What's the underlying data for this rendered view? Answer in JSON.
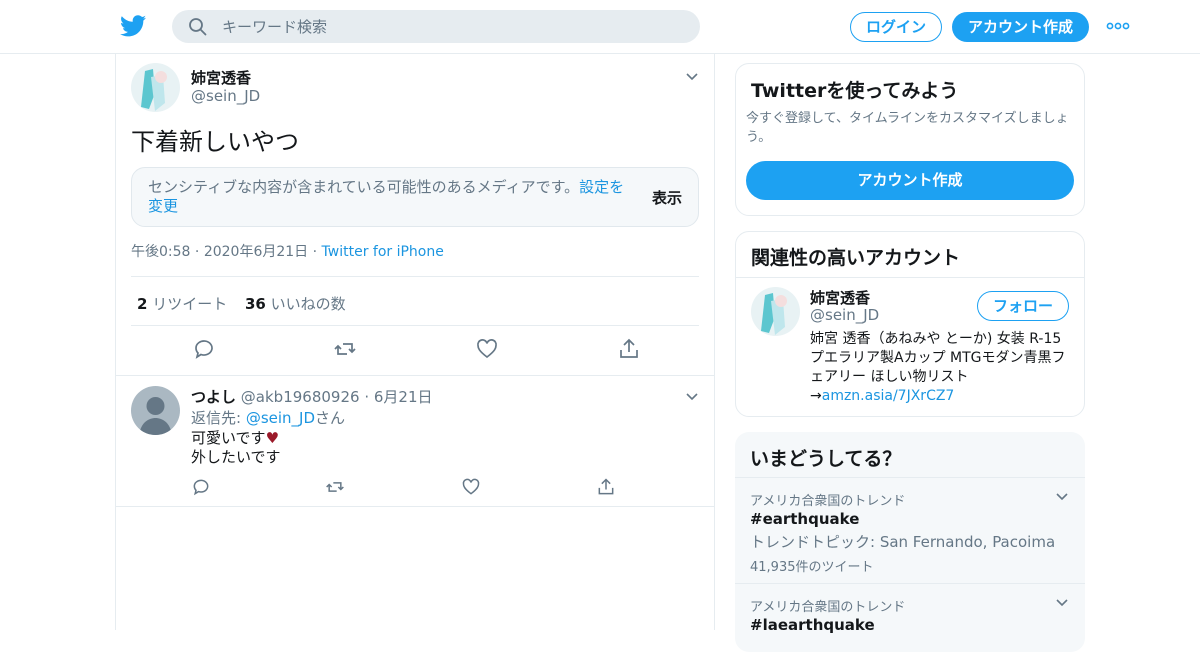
{
  "header": {
    "search_placeholder": "キーワード検索",
    "login_label": "ログイン",
    "signup_label": "アカウント作成"
  },
  "tweet": {
    "display_name": "姉宮透香",
    "handle": "@sein_JD",
    "text": "下着新しいやつ",
    "sensitive_message": "センシティブな内容が含まれている可能性のあるメディアです。",
    "sensitive_link": "設定を変更",
    "sensitive_show": "表示",
    "time": "午後0:58",
    "date": "2020年6月21日",
    "source": "Twitter for iPhone",
    "retweet_count": "2",
    "retweet_label": "リツイート",
    "like_count": "36",
    "like_label": "いいねの数"
  },
  "reply": {
    "display_name": "つよし",
    "handle": "@akb19680926",
    "date": "6月21日",
    "reply_prefix": "返信先: ",
    "reply_handle": "@sein_JD",
    "reply_suffix": "さん",
    "line1": "可愛いです",
    "line2": "外したいです"
  },
  "signup_card": {
    "title": "Twitterを使ってみよう",
    "description": "今すぐ登録して、タイムラインをカスタマイズしましょう。",
    "button": "アカウント作成"
  },
  "related_card": {
    "title": "関連性の高いアカウント",
    "display_name": "姉宮透香",
    "handle": "@sein_JD",
    "follow_label": "フォロー",
    "bio": "姉宮 透香（あねみや とーか) 女装 R-15 プエラリア製Aカップ MTGモダン青黒フェアリー ほしい物リスト→",
    "bio_link": "amzn.asia/7JXrCZ7"
  },
  "trends_card": {
    "title": "いまどうしてる？",
    "items": [
      {
        "context": "アメリカ合衆国のトレンド",
        "tag": "#earthquake",
        "topic": "トレンドトピック: San Fernando, Pacoima",
        "count": "41,935件のツイート"
      },
      {
        "context": "アメリカ合衆国のトレンド",
        "tag": "#laearthquake"
      }
    ]
  },
  "colors": {
    "brand": "#1da1f2",
    "link": "#1b95e0",
    "muted": "#657786"
  }
}
